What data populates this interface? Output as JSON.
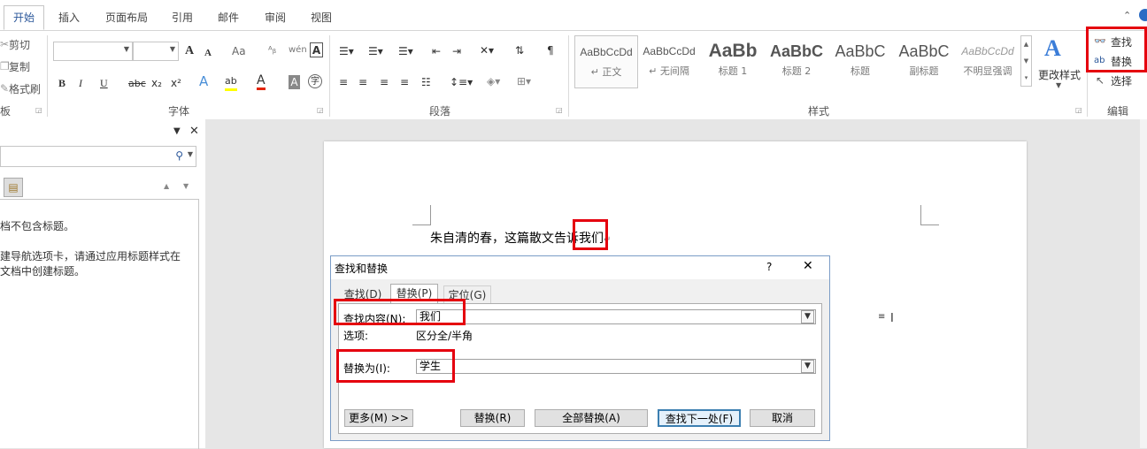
{
  "tabs": [
    "开始",
    "插入",
    "页面布局",
    "引用",
    "邮件",
    "审阅",
    "视图"
  ],
  "clipboard": {
    "cut": "剪切",
    "copy": "复制",
    "format_painter": "格式刷",
    "group_label": "板"
  },
  "font": {
    "group_label": "字体",
    "grow": "A",
    "shrink": "A",
    "case": "Aa"
  },
  "paragraph": {
    "group_label": "段落"
  },
  "styles": {
    "group_label": "样式",
    "items": [
      {
        "sample": "AaBbCcDd",
        "name": "↵ 正文"
      },
      {
        "sample": "AaBbCcDd",
        "name": "↵ 无间隔"
      },
      {
        "sample": "AaBb",
        "name": "标题 1"
      },
      {
        "sample": "AaBbC",
        "name": "标题 2"
      },
      {
        "sample": "AaBbC",
        "name": "标题"
      },
      {
        "sample": "AaBbC",
        "name": "副标题"
      },
      {
        "sample": "AaBbCcDd",
        "name": "不明显强调"
      }
    ],
    "change_styles": "更改样式"
  },
  "editing": {
    "find": "查找",
    "replace": "替换",
    "select": "选择",
    "group_label": "编辑"
  },
  "nav": {
    "empty_msg": "档不包含标题。",
    "hint_line1": "建导航选项卡，请通过应用标题样式在",
    "hint_line2": "文档中创建标题。"
  },
  "document": {
    "text_before": "朱自清的春，这篇散文告诉",
    "text_highlight": "我们"
  },
  "dialog": {
    "title": "查找和替换",
    "help": "?",
    "close": "✕",
    "tabs": [
      "查找(D)",
      "替换(P)",
      "定位(G)"
    ],
    "find_label": "查找内容(N):",
    "find_value": "我们",
    "options_label": "选项:",
    "options_value": "区分全/半角",
    "replace_label": "替换为(I):",
    "replace_value": "学生",
    "buttons": {
      "more": "更多(M) >>",
      "replace": "替换(R)",
      "replace_all": "全部替换(A)",
      "find_next": "查找下一处(F)",
      "cancel": "取消"
    }
  },
  "colors": {
    "accent": "#2b579a",
    "highlight_red": "#e5000e",
    "font_color_red": "#e32400",
    "highlighter_yellow": "#ffff00"
  }
}
